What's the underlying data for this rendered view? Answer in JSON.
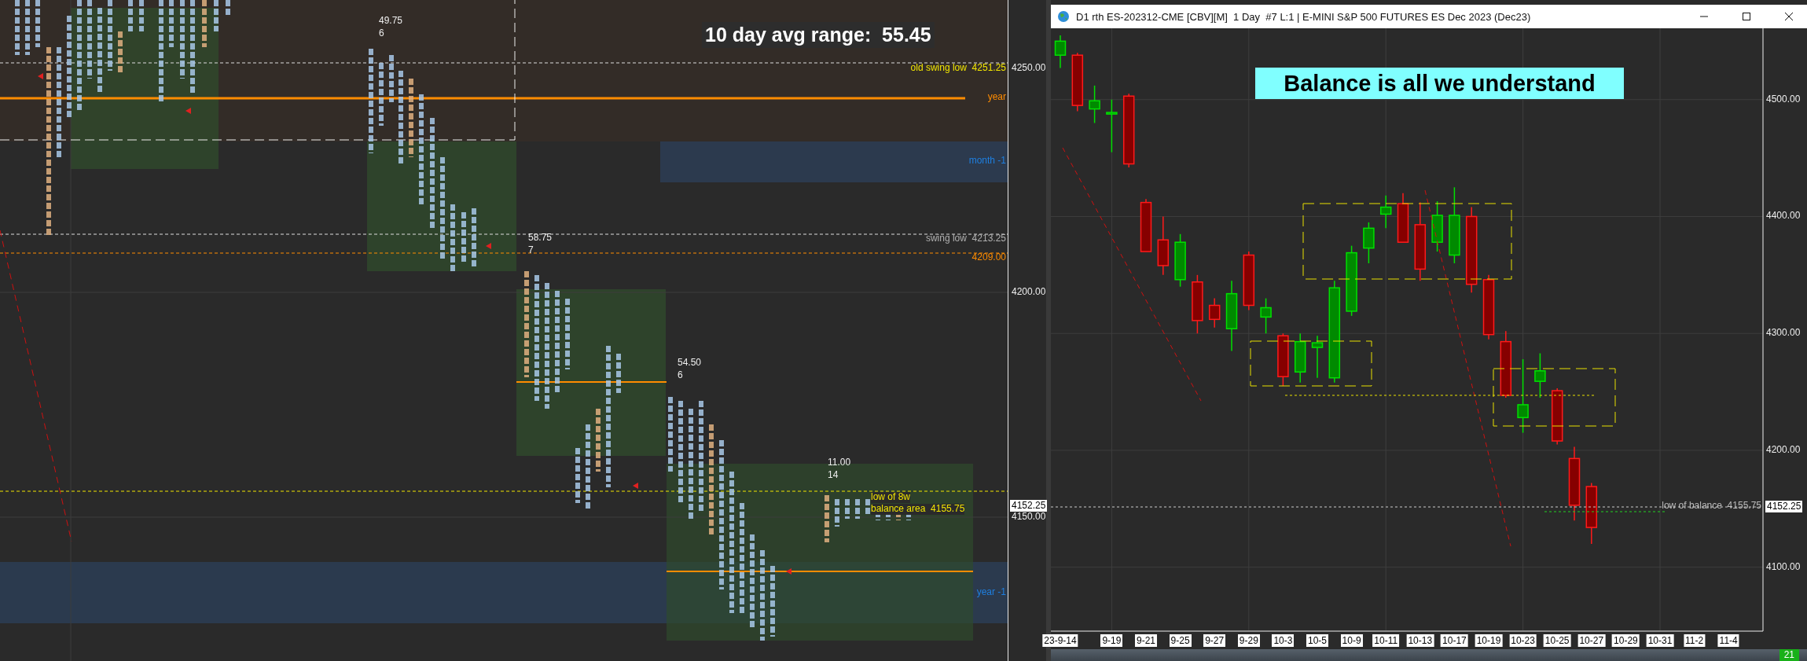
{
  "left_chart": {
    "headline": "10 day avg range:  55.45",
    "session_stats": [
      {
        "range": "49.75",
        "count": "6"
      },
      {
        "range": "58.75",
        "count": "7"
      },
      {
        "range": "54.50",
        "count": "6"
      },
      {
        "range": "11.00",
        "count": "14"
      }
    ],
    "levels": [
      {
        "kind": "swing",
        "label": "old swing low",
        "value": "4251.25"
      },
      {
        "kind": "year",
        "label": "year"
      },
      {
        "kind": "month",
        "label": "month -1"
      },
      {
        "kind": "reference",
        "label": "swing low",
        "value": "4213.25"
      },
      {
        "kind": "pivot",
        "value": "4209.00"
      },
      {
        "kind": "balance",
        "label": "low of 8w"
      },
      {
        "kind": "balance",
        "label": "balance area",
        "value": "4155.75"
      },
      {
        "kind": "month",
        "label": "year -1"
      }
    ],
    "price_axis": [
      "4250.00",
      "4200.00",
      "4150.00"
    ],
    "current_price": "4152.25"
  },
  "right_window": {
    "title": "D1 rth ES-202312-CME [CBV][M]  1 Day  #7 L:1 | E-MINI S&P 500 FUTURES ES Dec 2023 (Dec23)",
    "banner": "Balance is all we understand",
    "level_label": {
      "label": "low of balance",
      "value": "4155.75"
    },
    "chart_data": {
      "type": "candlestick",
      "categories": [
        "23-9-14",
        null,
        null,
        "9-19",
        null,
        "9-21",
        null,
        "9-25",
        null,
        "9-27",
        null,
        "9-29",
        null,
        "10-3",
        null,
        "10-5",
        null,
        "10-9",
        null,
        "10-11",
        null,
        "10-13",
        null,
        "10-17",
        null,
        "10-19",
        null,
        "10-23",
        null,
        "10-25",
        null,
        "10-27",
        null,
        "10-29",
        null,
        "10-31",
        null,
        "11-2",
        null,
        "11-4"
      ],
      "ylim": [
        4046,
        4561
      ],
      "grid": true,
      "ohlc": [
        [
          4538,
          4555,
          4527,
          4550
        ],
        [
          4538,
          4540,
          4490,
          4495
        ],
        [
          4492,
          4512,
          4480,
          4499
        ],
        [
          4489,
          4500,
          4455,
          4489
        ],
        [
          4503,
          4505,
          4442,
          4445
        ],
        [
          4412,
          4415,
          4370,
          4370
        ],
        [
          4380,
          4400,
          4350,
          4358
        ],
        [
          4346,
          4385,
          4340,
          4378
        ],
        [
          4344,
          4350,
          4300,
          4311
        ],
        [
          4324,
          4330,
          4305,
          4312
        ],
        [
          4304,
          4345,
          4285,
          4334
        ],
        [
          4367,
          4370,
          4320,
          4324
        ],
        [
          4314,
          4330,
          4300,
          4322
        ],
        [
          4298,
          4300,
          4255,
          4263
        ],
        [
          4267,
          4300,
          4258,
          4293
        ],
        [
          4288,
          4298,
          4262,
          4292
        ],
        [
          4262,
          4345,
          4258,
          4339
        ],
        [
          4319,
          4375,
          4315,
          4369
        ],
        [
          4373,
          4395,
          4360,
          4390
        ],
        [
          4402,
          4418,
          4390,
          4408
        ],
        [
          4411,
          4420,
          4378,
          4378
        ],
        [
          4393,
          4412,
          4345,
          4355
        ],
        [
          4378,
          4413,
          4370,
          4401
        ],
        [
          4367,
          4425,
          4360,
          4401
        ],
        [
          4400,
          4408,
          4335,
          4342
        ],
        [
          4346,
          4350,
          4295,
          4299
        ],
        [
          4293,
          4302,
          4245,
          4247
        ],
        [
          4228,
          4278,
          4215,
          4239
        ],
        [
          4259,
          4283,
          4245,
          4268
        ],
        [
          4251,
          4253,
          4205,
          4208
        ],
        [
          4193,
          4203,
          4140,
          4153
        ],
        [
          4169,
          4172,
          4120,
          4134
        ],
        null,
        null,
        null,
        null,
        null,
        null,
        null,
        null
      ],
      "yticks": [
        {
          "value": 4500,
          "label": "4500.00"
        },
        {
          "value": 4400,
          "label": "4400.00"
        },
        {
          "value": 4300,
          "label": "4300.00"
        },
        {
          "value": 4200,
          "label": "4200.00"
        },
        {
          "value": 4100,
          "label": "4100.00"
        }
      ]
    },
    "current_price": "4152.25",
    "status_badge": "21"
  }
}
